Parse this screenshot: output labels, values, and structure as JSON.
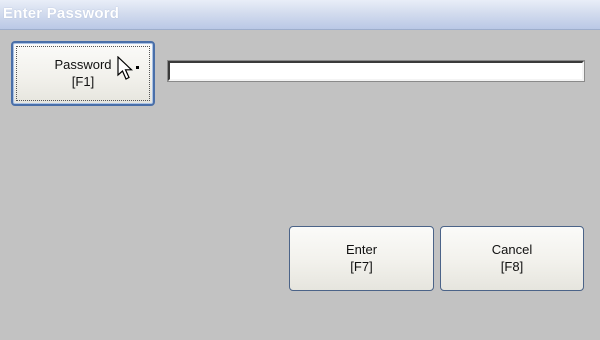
{
  "window": {
    "title": "Enter Password"
  },
  "password_button": {
    "label_line1": "Password",
    "label_line2": "[F1]"
  },
  "password_field": {
    "value": "",
    "placeholder": ""
  },
  "enter_button": {
    "label_line1": "Enter",
    "label_line2": "[F7]"
  },
  "cancel_button": {
    "label_line1": "Cancel",
    "label_line2": "[F8]"
  },
  "cursor": {
    "icon": "mouse-pointer-icon"
  }
}
